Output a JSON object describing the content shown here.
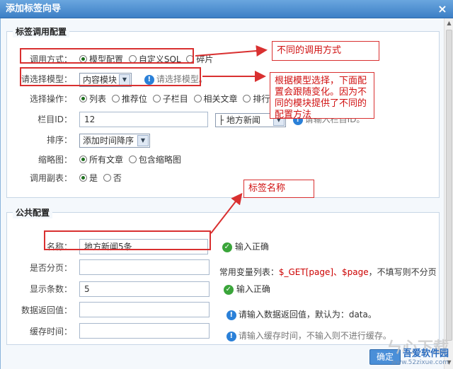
{
  "window": {
    "title": "添加标签向导",
    "close": "×"
  },
  "section1": {
    "legend": "标签调用配置",
    "call_method": {
      "label": "调用方式：",
      "options": [
        "模型配置",
        "自定义SQL",
        "碎片"
      ],
      "selected": 0
    },
    "model": {
      "label": "请选择模型：",
      "value": "内容模块",
      "hint": "请选择模型。"
    },
    "operation": {
      "label": "选择操作：",
      "options": [
        "列表",
        "推荐位",
        "子栏目",
        "相关文章",
        "排行榜"
      ],
      "selected": 0
    },
    "column_id": {
      "label": "栏目ID：",
      "value": "12",
      "select_value": "├ 地方新闻",
      "hint": "请输入栏目ID。"
    },
    "sort": {
      "label": "排序：",
      "value": "添加时间降序"
    },
    "thumb": {
      "label": "缩略图：",
      "options": [
        "所有文章",
        "包含缩略图"
      ],
      "selected": 0
    },
    "sub_table": {
      "label": "调用副表：",
      "options": [
        "是",
        "否"
      ],
      "selected": 0
    }
  },
  "section2": {
    "legend": "公共配置",
    "name": {
      "label": "名称：",
      "value": "地方新闻5条",
      "status": "输入正确"
    },
    "paging": {
      "label": "是否分页：",
      "value": "",
      "hint_prefix": "常用变量列表：",
      "hint_vars": "$_GET[page]、$page",
      "hint_suffix": "，不填写则不分页"
    },
    "count": {
      "label": "显示条数：",
      "value": "5",
      "status": "输入正确"
    },
    "return_value": {
      "label": "数据返回值：",
      "value": "",
      "hint": "请输入数据返回值，默认为：data。"
    },
    "cache": {
      "label": "缓存时间：",
      "value": "",
      "hint": "请输入缓存时间，不输入则不进行缓存。"
    }
  },
  "annotations": {
    "note1": "不同的调用方式",
    "note2": "根据模型选择，下面配置会跟随变化。因为不同的模块提供了不同的配置方法",
    "note3": "标签名称"
  },
  "footer": {
    "submit": "确定"
  },
  "watermark": {
    "big": "ㄣ心下载",
    "site": "吾爱软件园",
    "url": "www.52zixue.com"
  },
  "colors": {
    "title_bar": "#3c7fc6",
    "annotation": "#d93030",
    "ok": "#3aa53a",
    "info": "#2a80d8"
  }
}
